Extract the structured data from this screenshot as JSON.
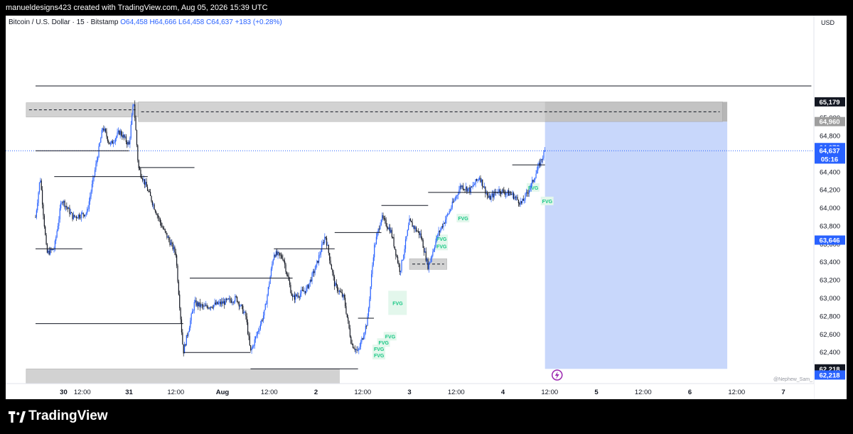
{
  "header": {
    "attribution": "manueldesigns423 created with TradingView.com, Aug 05, 2026 15:39 UTC"
  },
  "legend": {
    "symbol": "Bitcoin / U.S. Dollar · 15 · Bitstamp",
    "o": "O64,458",
    "h": "H64,666",
    "l": "L64,458",
    "c": "C64,637",
    "chg": "+183 (+0.28%)"
  },
  "footer": {
    "brand": "TradingView"
  },
  "watermark": "@Nephew_Sam_",
  "colors": {
    "up": "#2962ff",
    "down": "#131722",
    "fvg_text": "#16c784",
    "fvg_bg": "#e3f7ec",
    "zone": "#c7c7c7",
    "position": "#c8d7fb",
    "last_price": "#2962ff",
    "dark_tag": "#131722"
  },
  "chart_data": {
    "type": "candlestick",
    "currency": "USD",
    "y_ticks": [
      62400,
      62600,
      62800,
      63000,
      63200,
      63400,
      63600,
      63800,
      64000,
      64200,
      64400,
      64600,
      64800,
      65000,
      65200
    ],
    "y_tick_labels": [
      "62,400",
      "62,600",
      "62,800",
      "63,000",
      "63,200",
      "63,400",
      "63,600",
      "63,800",
      "64,000",
      "64,200",
      "64,400",
      "64,600",
      "64,800",
      "65,000",
      "65,200"
    ],
    "x_labels": [
      {
        "t": 0.3,
        "label": "30"
      },
      {
        "t": 0.5,
        "label": "12:00"
      },
      {
        "t": 1.0,
        "label": "31"
      },
      {
        "t": 1.5,
        "label": "12:00"
      },
      {
        "t": 2.0,
        "label": "Aug"
      },
      {
        "t": 2.5,
        "label": "12:00"
      },
      {
        "t": 3.0,
        "label": "2"
      },
      {
        "t": 3.5,
        "label": "12:00"
      },
      {
        "t": 4.0,
        "label": "3"
      },
      {
        "t": 4.5,
        "label": "12:00"
      },
      {
        "t": 5.0,
        "label": "4"
      },
      {
        "t": 5.5,
        "label": "12:00"
      },
      {
        "t": 6.0,
        "label": "5"
      },
      {
        "t": 6.5,
        "label": "12:00"
      },
      {
        "t": 7.0,
        "label": "6"
      },
      {
        "t": 7.5,
        "label": "12:00"
      },
      {
        "t": 8.0,
        "label": "7"
      }
    ],
    "price_path": [
      [
        0.0,
        63900
      ],
      [
        0.05,
        64350
      ],
      [
        0.12,
        63500
      ],
      [
        0.2,
        63550
      ],
      [
        0.28,
        64100
      ],
      [
        0.4,
        63900
      ],
      [
        0.55,
        63950
      ],
      [
        0.65,
        64500
      ],
      [
        0.72,
        64900
      ],
      [
        0.8,
        64700
      ],
      [
        0.9,
        64850
      ],
      [
        1.0,
        64700
      ],
      [
        1.05,
        65200
      ],
      [
        1.1,
        64450
      ],
      [
        1.2,
        64200
      ],
      [
        1.35,
        63800
      ],
      [
        1.5,
        63500
      ],
      [
        1.58,
        62400
      ],
      [
        1.7,
        62950
      ],
      [
        1.8,
        62900
      ],
      [
        2.0,
        62950
      ],
      [
        2.15,
        63000
      ],
      [
        2.25,
        62800
      ],
      [
        2.3,
        62400
      ],
      [
        2.45,
        62850
      ],
      [
        2.55,
        63500
      ],
      [
        2.65,
        63450
      ],
      [
        2.75,
        63000
      ],
      [
        2.9,
        63100
      ],
      [
        3.0,
        63350
      ],
      [
        3.1,
        63700
      ],
      [
        3.2,
        63150
      ],
      [
        3.3,
        63000
      ],
      [
        3.38,
        62500
      ],
      [
        3.45,
        62400
      ],
      [
        3.55,
        62750
      ],
      [
        3.62,
        63550
      ],
      [
        3.7,
        63900
      ],
      [
        3.8,
        63750
      ],
      [
        3.9,
        63300
      ],
      [
        4.0,
        63850
      ],
      [
        4.12,
        63700
      ],
      [
        4.2,
        63350
      ],
      [
        4.3,
        63700
      ],
      [
        4.42,
        63950
      ],
      [
        4.55,
        64250
      ],
      [
        4.65,
        64200
      ],
      [
        4.75,
        64350
      ],
      [
        4.85,
        64100
      ],
      [
        4.95,
        64200
      ],
      [
        5.1,
        64150
      ],
      [
        5.2,
        64050
      ],
      [
        5.3,
        64250
      ],
      [
        5.45,
        64637
      ]
    ],
    "levels": [
      {
        "t1": 0.0,
        "t2": 1.0,
        "p": 64637
      },
      {
        "t1": 0.0,
        "t2": 0.5,
        "p": 63550
      },
      {
        "t1": 0.2,
        "t2": 1.2,
        "p": 64350
      },
      {
        "t1": 1.1,
        "t2": 1.7,
        "p": 64450
      },
      {
        "t1": 0.0,
        "t2": 1.58,
        "p": 62720
      },
      {
        "t1": 1.58,
        "t2": 2.3,
        "p": 62400
      },
      {
        "t1": 1.65,
        "t2": 2.75,
        "p": 63225
      },
      {
        "t1": 2.3,
        "t2": 3.45,
        "p": 62218
      },
      {
        "t1": 2.55,
        "t2": 3.2,
        "p": 63550
      },
      {
        "t1": 3.2,
        "t2": 3.7,
        "p": 63730
      },
      {
        "t1": 3.45,
        "t2": 3.62,
        "p": 62780
      },
      {
        "t1": 3.7,
        "t2": 4.2,
        "p": 64030
      },
      {
        "t1": 4.2,
        "t2": 4.55,
        "p": 64175
      },
      {
        "t1": 4.55,
        "t2": 5.1,
        "p": 64175
      },
      {
        "t1": 5.1,
        "t2": 5.45,
        "p": 64480
      },
      {
        "t1": 0.0,
        "t2": 8.3,
        "p": 65355
      }
    ],
    "zones": [
      {
        "t1": -0.1,
        "t2": 1.1,
        "p1": 65010,
        "p2": 65170,
        "dashed": 65090
      },
      {
        "t1": 1.1,
        "t2": 7.35,
        "p1": 64960,
        "p2": 65179,
        "dashed": 65069
      },
      {
        "t1": -0.1,
        "t2": 3.25,
        "p1": 62218,
        "p2": 62000
      },
      {
        "t1": 4.0,
        "t2": 4.4,
        "p1": 63320,
        "p2": 63440,
        "dashed": 63380
      }
    ],
    "position": {
      "t1": 5.45,
      "t2": 7.4,
      "target_top": 65179,
      "target_bottom": 64960,
      "entry": 64960,
      "stop": 62218
    },
    "fvg": [
      {
        "t": 5.3,
        "p": 64230,
        "label": "FVG"
      },
      {
        "t": 5.45,
        "p": 64080,
        "label": "FVG"
      },
      {
        "t": 4.55,
        "p": 63890,
        "label": "FVG"
      },
      {
        "t": 4.32,
        "p": 63580,
        "label": "FVG"
      },
      {
        "t": 4.32,
        "p": 63660,
        "label": "FVG"
      },
      {
        "t": 3.85,
        "p": 62950,
        "label": "FVG"
      },
      {
        "t": 3.77,
        "p": 62580,
        "label": "FVG"
      },
      {
        "t": 3.7,
        "p": 62510,
        "label": "FVG"
      },
      {
        "t": 3.65,
        "p": 62440,
        "label": "FVG"
      },
      {
        "t": 3.65,
        "p": 62370,
        "label": "FVG"
      }
    ],
    "price_labels": [
      {
        "p": 65179,
        "label": "65,179",
        "kind": "dark"
      },
      {
        "p": 64960,
        "label": "64,960",
        "kind": "grey"
      },
      {
        "p": 64672,
        "label": "64,672",
        "kind": "blue"
      },
      {
        "p": 64637,
        "label": "64,637",
        "kind": "blue"
      },
      {
        "p": 64545,
        "label": "05:16",
        "kind": "blue"
      },
      {
        "p": 63646,
        "label": "63,646",
        "kind": "blue"
      },
      {
        "p": 62218,
        "label": "62,218",
        "kind": "dark"
      },
      {
        "p": 62150,
        "label": "62,218",
        "kind": "blue"
      }
    ]
  }
}
